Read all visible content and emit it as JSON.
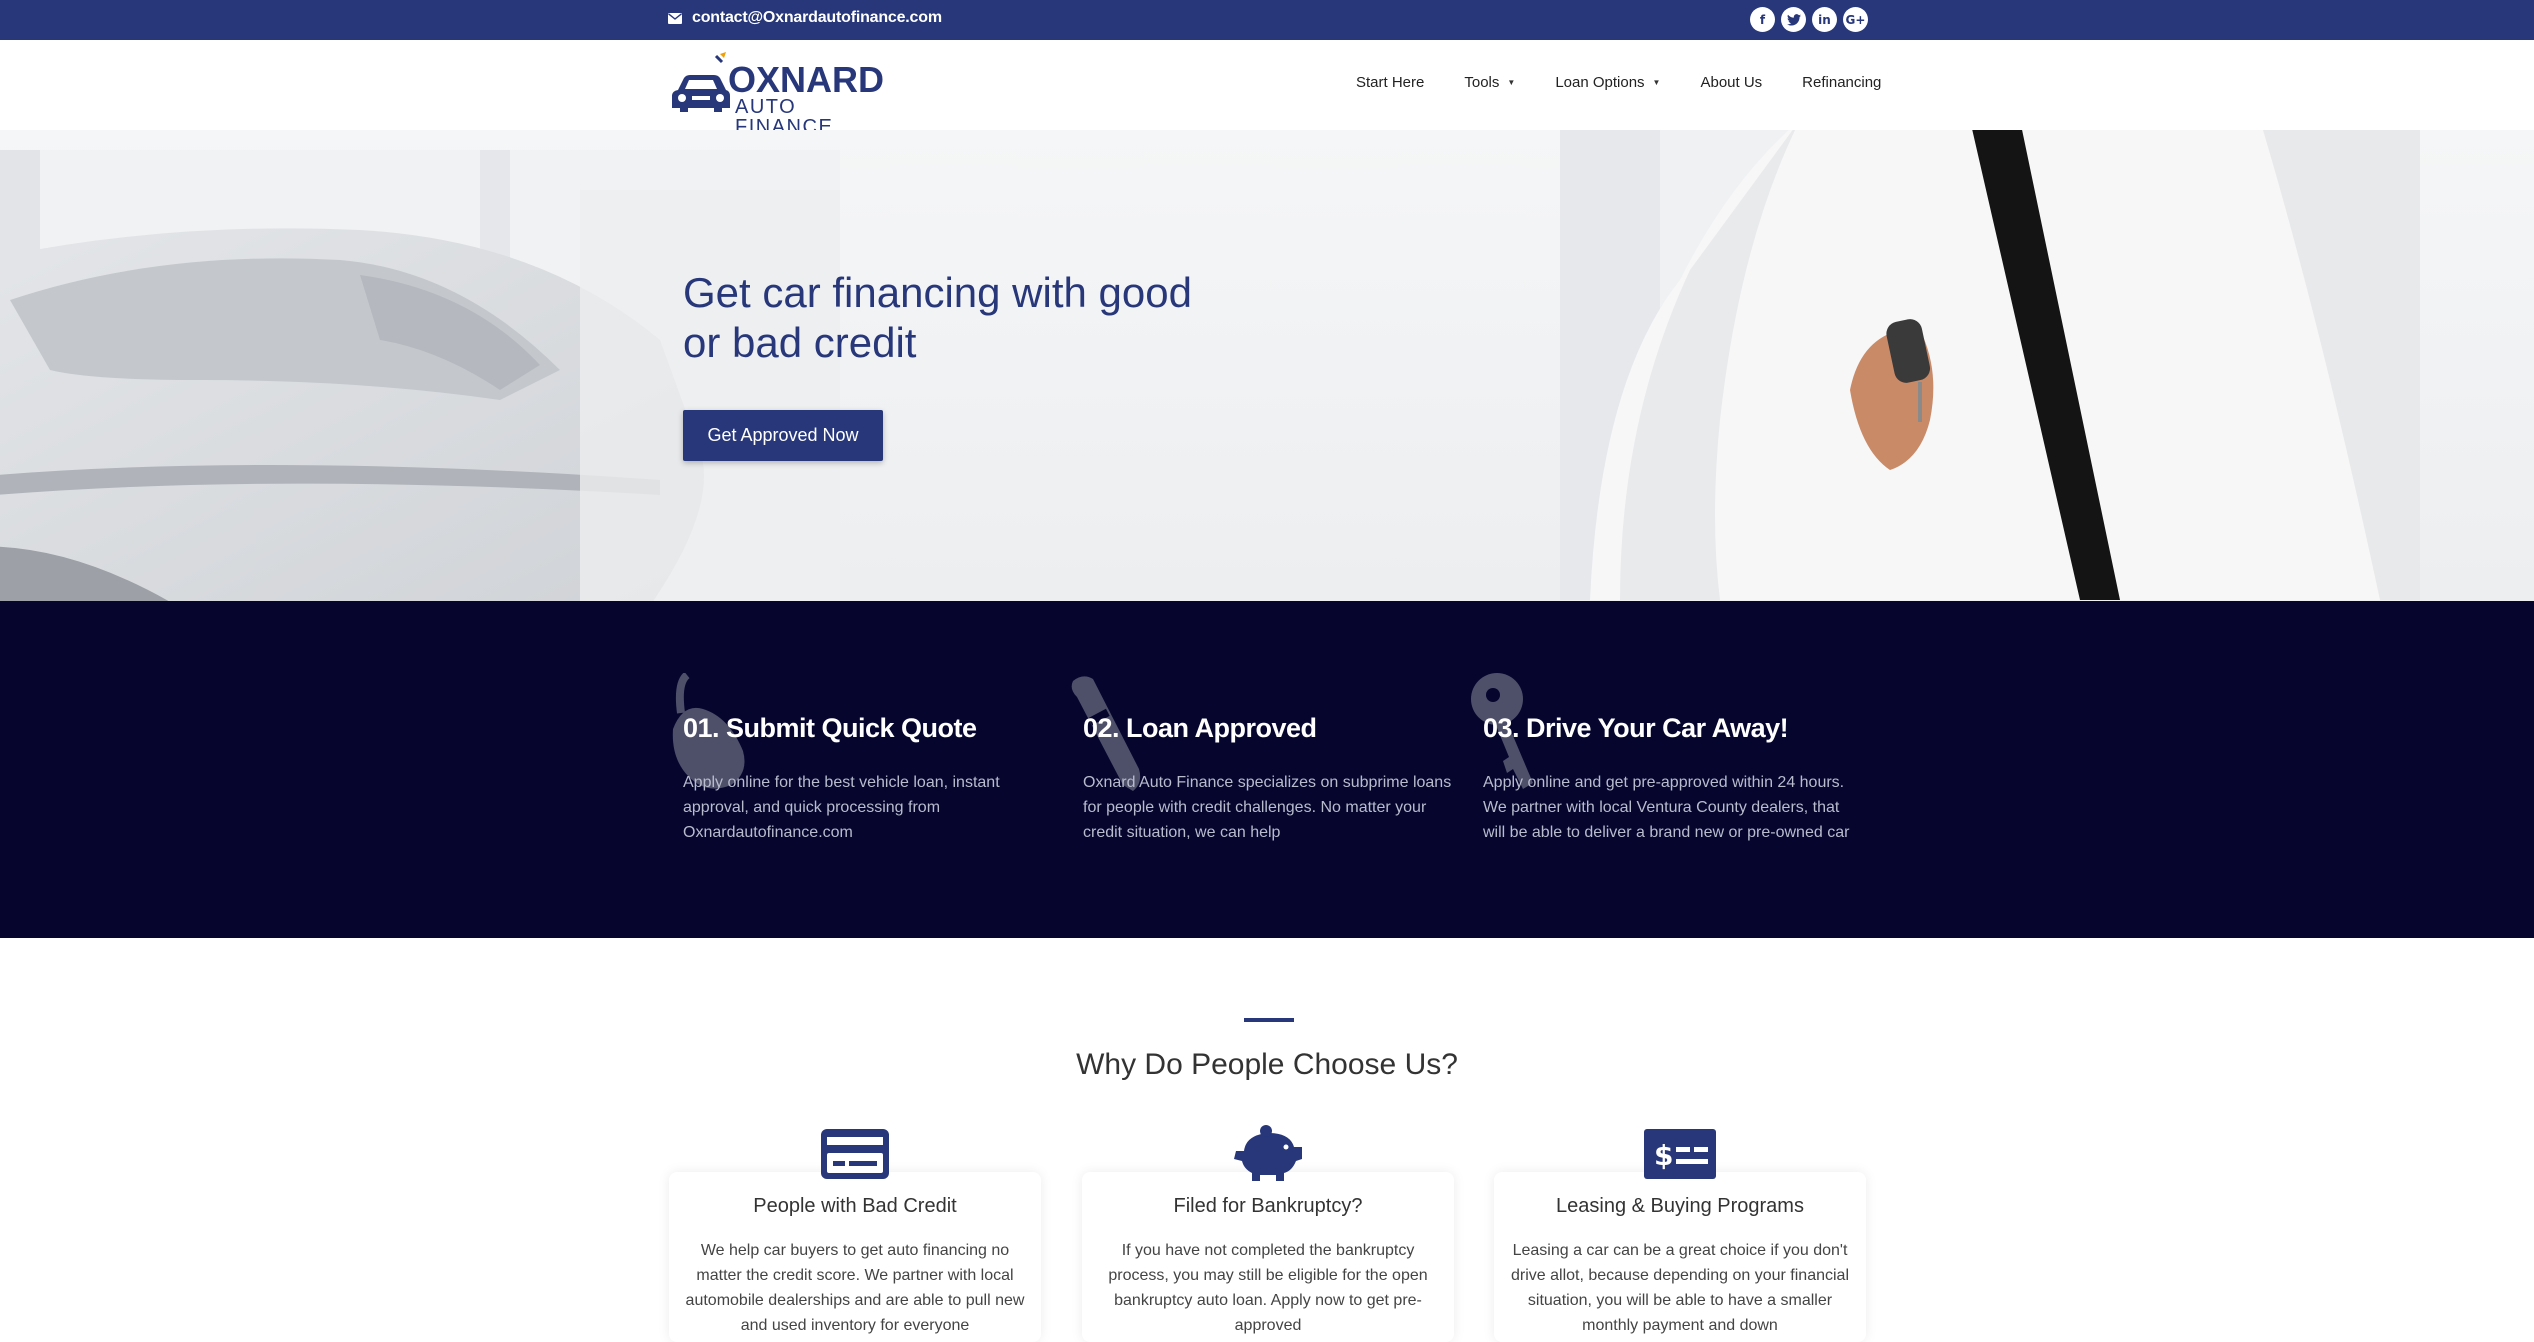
{
  "topbar": {
    "email": "contact@Oxnardautofinance.com",
    "socials": [
      {
        "icon": "facebook-icon",
        "glyph": "f"
      },
      {
        "icon": "twitter-icon",
        "glyph": "t"
      },
      {
        "icon": "linkedin-icon",
        "glyph": "in"
      },
      {
        "icon": "google-plus-icon",
        "glyph": "G+"
      }
    ]
  },
  "logo": {
    "line1": "OXNARD",
    "line2": "AUTO FINANCE"
  },
  "nav": {
    "items": [
      {
        "label": "Start Here",
        "dropdown": false
      },
      {
        "label": "Tools",
        "dropdown": true
      },
      {
        "label": "Loan Options",
        "dropdown": true
      },
      {
        "label": "About Us",
        "dropdown": false
      },
      {
        "label": "Refinancing",
        "dropdown": false
      }
    ]
  },
  "hero": {
    "title": "Get car financing with good or bad credit",
    "cta": "Get Approved Now"
  },
  "steps": [
    {
      "title": "01. Submit Quick Quote",
      "text": "Apply online for the best vehicle loan, instant approval, and quick processing from Oxnardautofinance.com",
      "icon": "mouse-icon"
    },
    {
      "title": "02. Loan Approved",
      "text": "Oxnard Auto Finance specializes on subprime loans for people with credit challenges. No matter your credit situation, we can help",
      "icon": "pen-icon"
    },
    {
      "title": "03. Drive Your Car Away!",
      "text": "Apply online and get pre-approved within 24 hours. We partner with local Ventura County dealers, that will be able to deliver a brand new or pre-owned car",
      "icon": "key-icon"
    }
  ],
  "why": {
    "title": "Why Do People Choose Us?",
    "cards": [
      {
        "title": "People with Bad Credit",
        "text": "We help car buyers to get auto financing no matter the credit score. We partner with local automobile dealerships and are able to pull new and used inventory for everyone",
        "icon": "credit-card-icon"
      },
      {
        "title": "Filed for Bankruptcy?",
        "text": "If you have not completed the bankruptcy process, you may still be eligible for the open bankruptcy auto loan. Apply now to get pre-approved",
        "icon": "piggy-bank-icon"
      },
      {
        "title": "Leasing & Buying Programs",
        "text": "Leasing a car can be a great choice if you don't drive allot, because depending on your financial situation, you will be able to have a smaller monthly payment and down",
        "icon": "money-bill-icon"
      }
    ]
  },
  "colors": {
    "brand": "#27377a",
    "dark": "#05052e"
  }
}
